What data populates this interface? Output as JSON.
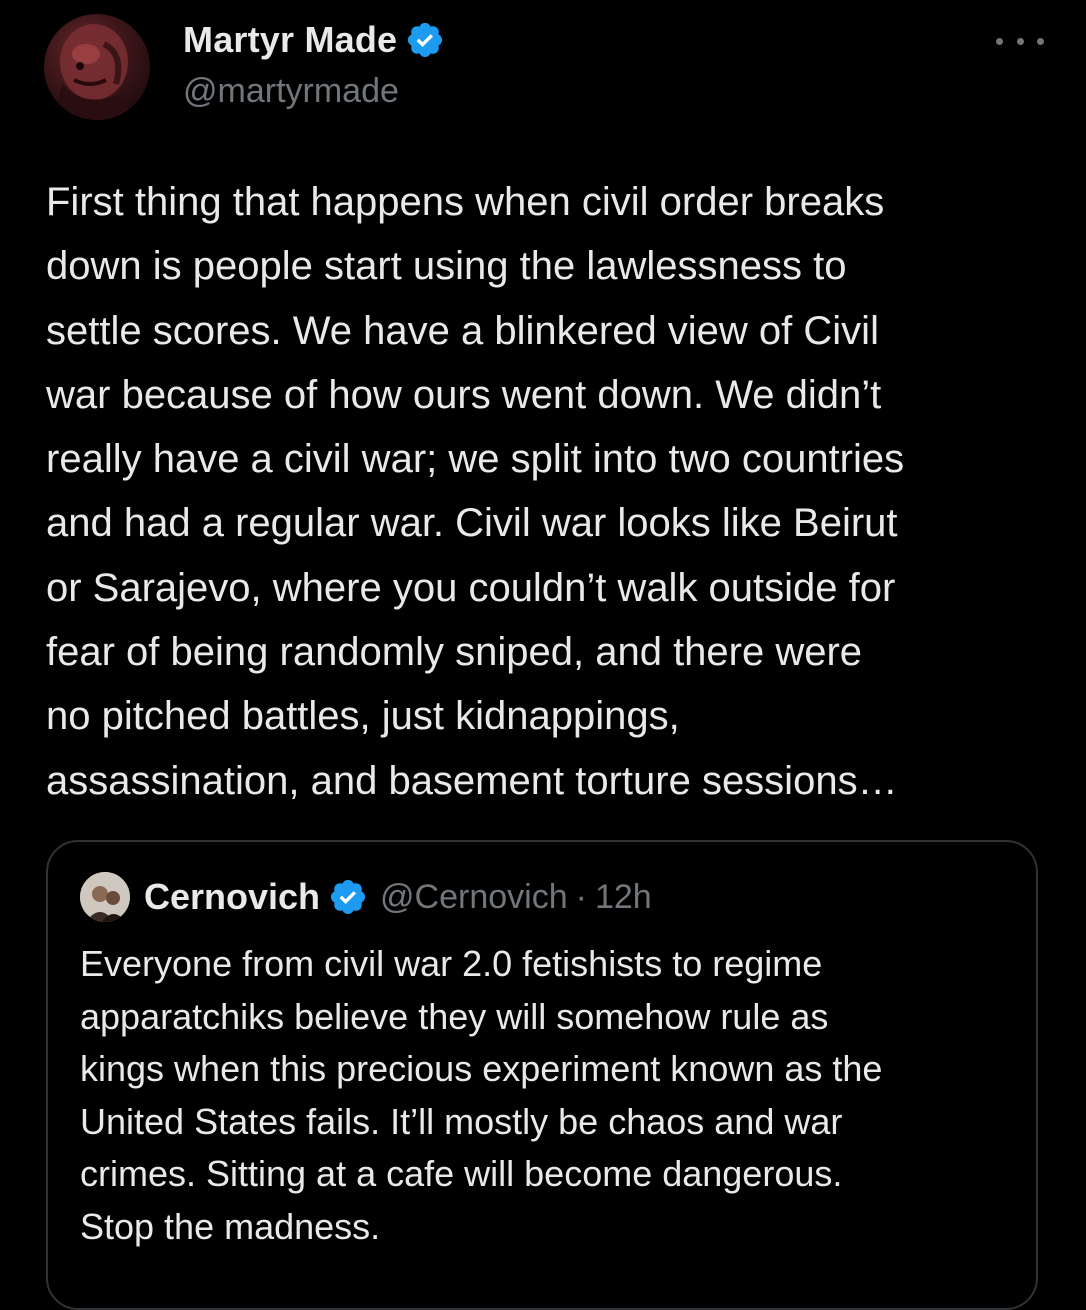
{
  "tweet": {
    "author_name": "Martyr Made",
    "author_handle": "@martyrmade",
    "verified_icon": "verified-badge-icon",
    "more_icon": "more-options-icon",
    "text": "First thing that happens when civil order breaks\ndown is people start using the lawlessness to\nsettle scores. We have a blinkered view of Civil\nwar because of how ours went down. We didn’t\nreally have a civil war; we split into two countries\nand had a regular war. Civil war looks like Beirut\nor Sarajevo, where you couldn’t walk outside for\nfear of being randomly sniped, and there were\nno pitched battles, just kidnappings,\nassassination, and basement torture sessions…"
  },
  "quote": {
    "author_name": "Cernovich",
    "author_handle": "@Cernovich",
    "separator": "·",
    "time": "12h",
    "text": "Everyone from civil war 2.0 fetishists to regime\napparatchiks believe they will somehow rule as\nkings when this precious experiment known as the\nUnited States fails. It’ll mostly be chaos and war\ncrimes. Sitting at a cafe will become dangerous.\nStop the madness."
  },
  "colors": {
    "background": "#000000",
    "text_primary": "#e7e9ea",
    "text_secondary": "#71767b",
    "verified_blue": "#1d9bf0",
    "card_border": "#2f3336"
  }
}
